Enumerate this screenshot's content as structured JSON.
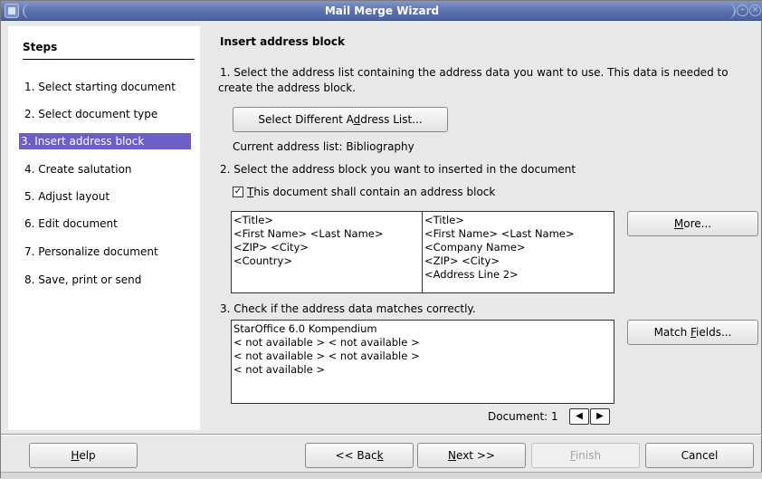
{
  "window": {
    "title": "Mail Merge Wizard"
  },
  "steps": {
    "title": "Steps",
    "items": [
      {
        "label": "1. Select starting document"
      },
      {
        "label": "2. Select document type"
      },
      {
        "label": "3. Insert address block",
        "active": true
      },
      {
        "label": "4. Create salutation"
      },
      {
        "label": "5. Adjust layout"
      },
      {
        "label": "6. Edit document"
      },
      {
        "label": "7. Personalize document"
      },
      {
        "label": "8. Save, print or send"
      }
    ]
  },
  "main": {
    "heading": "Insert address block",
    "instr1_line1": "1. Select the address list containing the address data you want to use. This data is needed to",
    "instr1_line2": "create the address block.",
    "select_list_button": "Select Different Address List...",
    "current_list": "Current address list: Bibliography",
    "instr2": "2. Select the address block you want to inserted in the document",
    "contain_checkbox_label": "This document shall contain an address block",
    "contain_checked": true,
    "address_block_1": [
      "<Title>",
      "<First Name> <Last Name>",
      "<ZIP> <City>",
      "<Country>"
    ],
    "address_block_2": [
      "<Title>",
      "<First Name> <Last Name>",
      "<Company Name>",
      "<ZIP> <City>",
      "<Address Line 2>"
    ],
    "more_button": "More...",
    "instr3": "3. Check if the address data matches correctly.",
    "preview_lines": [
      "StarOffice 6.0 Kompendium",
      "< not available > < not available >",
      "< not available > < not available >",
      "< not available >"
    ],
    "match_fields_button": "Match Fields...",
    "document_label": "Document: 1"
  },
  "footer": {
    "help": "Help",
    "back": "<< Back",
    "next": "Next >>",
    "finish": "Finish",
    "cancel": "Cancel"
  },
  "colors": {
    "titlebar": "#5a6fae",
    "selected_step": "#6b5ec4"
  }
}
